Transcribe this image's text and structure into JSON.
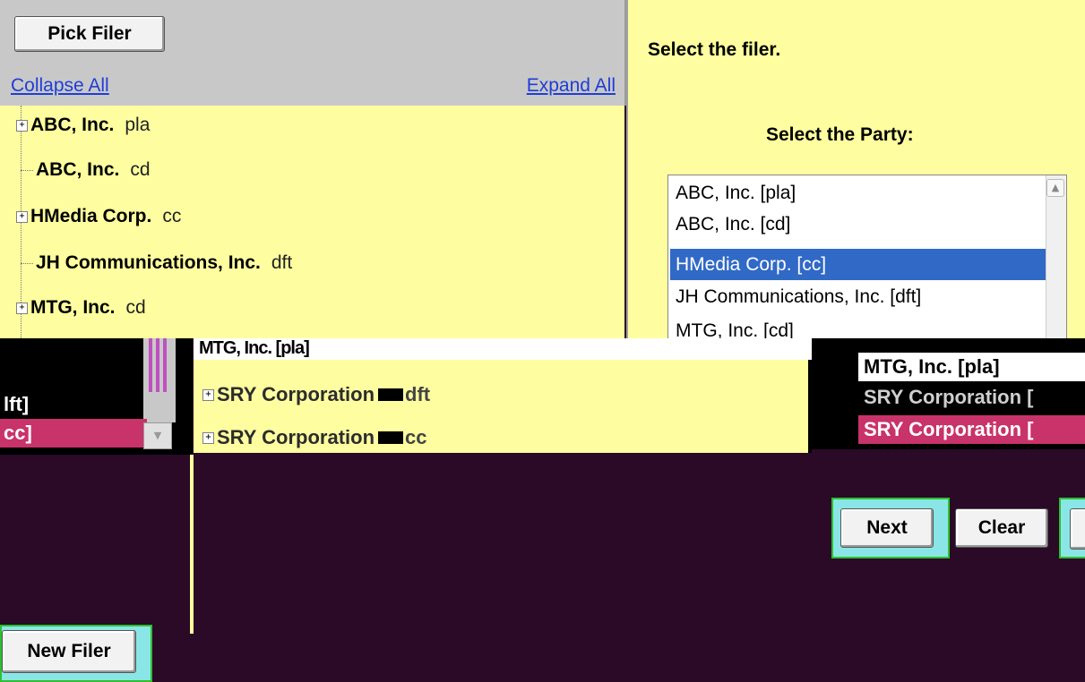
{
  "toolbar": {
    "pick_filer_label": "Pick Filer"
  },
  "links": {
    "collapse_all": "Collapse All",
    "expand_all": "Expand All"
  },
  "tree": [
    {
      "name": "ABC, Inc.",
      "role": "pla",
      "expandable": true
    },
    {
      "name": "ABC, Inc.",
      "role": "cd",
      "expandable": false
    },
    {
      "name": "HMedia Corp.",
      "role": "cc",
      "expandable": true
    },
    {
      "name": "JH Communications, Inc.",
      "role": "dft",
      "expandable": false
    },
    {
      "name": "MTG, Inc.",
      "role": "cd",
      "expandable": true
    }
  ],
  "right_panel": {
    "instruction": "Select the filer.",
    "party_label": "Select the Party:",
    "party_options": [
      "ABC, Inc. [pla]",
      "ABC, Inc. [cd]",
      "HMedia Corp. [cc]",
      "JH Communications, Inc. [dft]",
      "MTG, Inc. [cd]"
    ],
    "selected_option": "HMedia Corp. [cc]"
  },
  "bottom_left": {
    "item1": "lft]",
    "item2": "cc]",
    "new_filer_label": "New Filer"
  },
  "bottom_middle": {
    "strip_text": "MTG, Inc. [pla]",
    "rows": [
      {
        "name": "SRY Corporation",
        "role": "dft"
      },
      {
        "name": "SRY Corporation",
        "role": "cc"
      }
    ]
  },
  "bottom_right": {
    "items": [
      "MTG, Inc. [pla]",
      "SRY Corporation [",
      "SRY Corporation ["
    ],
    "next_label": "Next",
    "clear_label": "Clear"
  },
  "colors": {
    "panel_yellow": "#fefea0",
    "toolbar_gray": "#c8c8c8",
    "selection_blue": "#3169c6",
    "selection_pink": "#c8336a",
    "link_blue": "#1f3dd6",
    "focus_cyan": "#8ae6e6",
    "focus_green": "#2ec02e"
  },
  "icons": {
    "expander": "plus-box-icon",
    "scroll_up": "scroll-up-arrow-icon"
  }
}
